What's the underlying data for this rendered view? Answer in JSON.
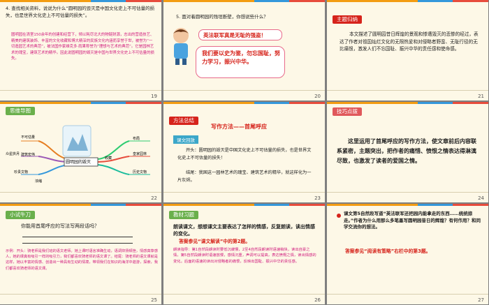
{
  "slides": [
    {
      "number": "19",
      "question": "4. 查找相关资料，说说为什么“圆明园的毁灭是中国文化史上不可估量的损失，也是世界文化史上不可估量的损失”。",
      "answer": "圆明园在清室150余年的创建和经营下，倾以耗尽北大的物链财源，志出的营造技艺、精美的建筑装饰、丰富的文化收藏和博大精深的民族文化内涵而享誉于世，被誉为“一切造园艺术的典范”，被法国作家维克多·雨果称誉为“理想与艺术的典范”。它是园林艺术的瑰宝，建筑艺术的精华。因此说圆明园的毁灭是中国与世界文化史上不可估量的损失。"
    },
    {
      "number": "20",
      "question": "5. 面对着圆明园的残垣断壁，你想说些什么？",
      "bubble1": "英法联军真是无耻的强盗！",
      "bubble2": "我们要以史为鉴，勿忘国耻，努力学习，振兴中华。"
    },
    {
      "number": "21",
      "tab": "主题归纳",
      "text": "本文描述了圆明园昔日辉煌的景观和惨遭毁灭的悲惨的经过，表达了作者对祖国灿烂文化的无限热爱和对侵略者野蛮、无耻行径的无比痛恨，激发人们不忘国耻、振兴中华的责任感和使命感。"
    },
    {
      "number": "22",
      "tab": "思维导图",
      "center": "圆明园的毁灭",
      "left_nodes": [
        "不可估量",
        "众星拱月",
        "建筑宏伟",
        "珍贵文物"
      ],
      "right_nodes": [
        "布局",
        "皇家园林",
        "收藏",
        "历史文物"
      ],
      "bottom_label": "浓缩"
    },
    {
      "number": "23",
      "tab": "方法总结",
      "heading": "写作方法——首尾呼应",
      "label": "课文回放",
      "p1": "开头：圆明园的毁灭是中国文化史上不可估量的损失，也是世界文化史上不可估量的损失！",
      "p2": "结尾：我国这一园林艺术的瑰宝、建筑艺术的精华，就这样化为一片灰烬。"
    },
    {
      "number": "24",
      "tab": "技巧点拨",
      "text": "这里运用了首尾呼应的写作方法，使文章前后内容联系紧密，主题突出，把作者的痛惜、愤恨之情表达得淋漓尽致，也激发了读者的爱国之情。"
    },
    {
      "number": "25",
      "tab": "小试牛刀",
      "question": "你能用首尾呼应的写法写两段话吗？",
      "example": "示例：开头：骑老师是我们班的语文老师。她上课时语言准确生动，语调抑扬顿挫，情感真挚感人，她的课真有吸引一样的吸引力，我们都喜欢骑老师的语文课了。结尾：骑老师的语文课就是这样，她以丰富的情感、创造出一种具有生动的情境，带领我们在知识的海洋中遨游，探索，我们都喜欢骑老师的语文课。"
    },
    {
      "number": "26",
      "tab": "教材习题",
      "q": "朗读课文，想想课文主要表达了怎样的情感，反复朗读，读出情感的变化。",
      "ans": "答案参见“课文解读”中的第2题。",
      "detail": "朗读指导：第1自然段朗读时要低沉缓慢，2至4自然段朗读时语速稍快，读出自豪之情，第5自然段朗读时语速放慢，感情沉重，声调可以提高，表达愤慨之情，读出情感的变化。后面的语速的读出对侵略者的痛恨，反映出国耻、振兴中华的责任感。"
    },
    {
      "number": "27",
      "q": "课文第5自然段写道“英法联军还把园内能拿走的东西……统统掠走。”作者为什么用那么多笔墨写圆明园昔日的辉煌？有何作用？和同学交流你的想法。",
      "ans": "答案参见“阅读有策略”右栏中的第3题。"
    }
  ],
  "colors": {
    "gray": "#7f7f7f",
    "slide_bg": "#fdf8e7",
    "red_tab": "#d6231b",
    "magenta": "#d0187c",
    "blue": "#2a68b3",
    "green": "#6ab04c"
  }
}
